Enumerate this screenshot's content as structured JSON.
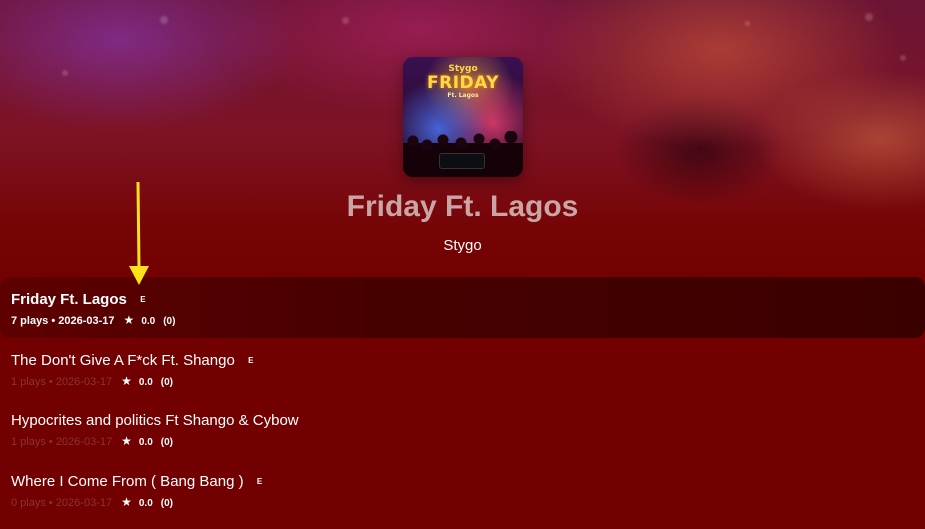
{
  "album": {
    "cover": {
      "artist_text": "Stygo",
      "title_text": "FRIDAY",
      "feature_text": "Ft. Lagos"
    },
    "title": "Friday Ft. Lagos",
    "artist": "Stygo"
  },
  "tracks": [
    {
      "title": "Friday Ft. Lagos",
      "explicit": "E",
      "meta": "7 plays • 2026-03-17",
      "star": "★",
      "rating": "0.0",
      "rating_count": "(0)",
      "active": true
    },
    {
      "title": "The Don't Give A F*ck Ft. Shango",
      "explicit": "E",
      "meta": "1 plays • 2026-03-17",
      "star": "★",
      "rating": "0.0",
      "rating_count": "(0)"
    },
    {
      "title": "Hypocrites and politics Ft Shango & Cybow",
      "explicit": "",
      "meta": "1 plays • 2026-03-17",
      "star": "★",
      "rating": "0.0",
      "rating_count": "(0)"
    },
    {
      "title": "Where I Come From ( Bang Bang )",
      "explicit": "E",
      "meta": "0 plays • 2026-03-17",
      "star": "★",
      "rating": "0.0",
      "rating_count": "(0)"
    }
  ],
  "annotation": {
    "icon": "arrow-down-icon",
    "color": "#ffe11a"
  },
  "colors": {
    "background": "#720000",
    "active_row": "#470000",
    "muted_text": "#8a3333"
  }
}
